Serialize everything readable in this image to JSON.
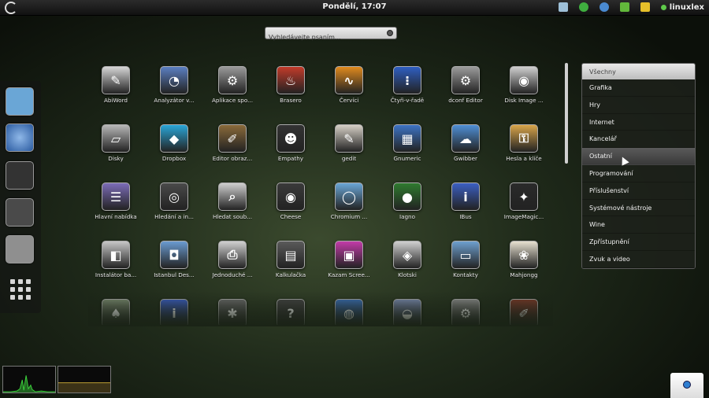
{
  "top_panel": {
    "clock": "Pondělí, 17:07",
    "user": "linuxlex",
    "tray_icons": [
      {
        "name": "screen-icon",
        "color": "#9ec0d8"
      },
      {
        "name": "network-icon",
        "color": "#3fae3f"
      },
      {
        "name": "globe-icon",
        "color": "#4a8ad0"
      },
      {
        "name": "rss-icon",
        "color": "#62b83b"
      },
      {
        "name": "sparkle-icon",
        "color": "#e6c02a"
      }
    ]
  },
  "search": {
    "placeholder": "Vyhledávejte psaním..."
  },
  "dock": {
    "items": [
      {
        "name": "chromium-icon",
        "color": "#6aa6d6"
      },
      {
        "name": "globe-icon",
        "color": "#3b6fb5"
      },
      {
        "name": "empathy-icon",
        "color": "#444444"
      },
      {
        "name": "binoculars-icon",
        "color": "#555555"
      },
      {
        "name": "file-cabinet-icon",
        "color": "#8f8f8f"
      }
    ]
  },
  "apps": [
    {
      "label": "AbiWord",
      "icon": "abiword-icon",
      "color": "#d6d6d6",
      "glyph": "✎"
    },
    {
      "label": "Analyzátor v...",
      "icon": "disk-analyzer-icon",
      "color": "#5b7fc2",
      "glyph": "◔"
    },
    {
      "label": "Aplikace spo...",
      "icon": "startup-apps-icon",
      "color": "#9a9a9a",
      "glyph": "⚙"
    },
    {
      "label": "Brasero",
      "icon": "brasero-icon",
      "color": "#c23b2a",
      "glyph": "♨"
    },
    {
      "label": "Červíci",
      "icon": "worms-icon",
      "color": "#e08a1e",
      "glyph": "∿"
    },
    {
      "label": "Čtyři-v-řadě",
      "icon": "four-in-row-icon",
      "color": "#2f5fc2",
      "glyph": "⁝"
    },
    {
      "label": "dconf Editor",
      "icon": "gear-icon",
      "color": "#9c9c9c",
      "glyph": "⚙"
    },
    {
      "label": "Disk Image ...",
      "icon": "disk-image-icon",
      "color": "#d0d0d0",
      "glyph": "◉"
    },
    {
      "label": "Disky",
      "icon": "disks-icon",
      "color": "#b8b8b8",
      "glyph": "▱"
    },
    {
      "label": "Dropbox",
      "icon": "dropbox-icon",
      "color": "#2aa6d8",
      "glyph": "◆"
    },
    {
      "label": "Editor obraz...",
      "icon": "gimp-icon",
      "color": "#8a6a3a",
      "glyph": "✐"
    },
    {
      "label": "Empathy",
      "icon": "empathy-icon",
      "color": "#333333",
      "glyph": "☻"
    },
    {
      "label": "gedit",
      "icon": "gedit-icon",
      "color": "#d6d0c6",
      "glyph": "✎"
    },
    {
      "label": "Gnumeric",
      "icon": "gnumeric-icon",
      "color": "#3d73c4",
      "glyph": "▦"
    },
    {
      "label": "Gwibber",
      "icon": "gwibber-icon",
      "color": "#4f8fd6",
      "glyph": "☁"
    },
    {
      "label": "Hesla a klíče",
      "icon": "keys-icon",
      "color": "#d9a54a",
      "glyph": "⚿"
    },
    {
      "label": "Hlavní nabídka",
      "icon": "main-menu-icon",
      "color": "#7c6cb8",
      "glyph": "☰"
    },
    {
      "label": "Hledání a in...",
      "icon": "binoculars-icon",
      "color": "#4a4a4a",
      "glyph": "◎"
    },
    {
      "label": "Hledat soub...",
      "icon": "magnifier-icon",
      "color": "#cfcfcf",
      "glyph": "⌕"
    },
    {
      "label": "Cheese",
      "icon": "cheese-icon",
      "color": "#3a3a3a",
      "glyph": "◉"
    },
    {
      "label": "Chromium ...",
      "icon": "chromium-icon",
      "color": "#6aa6d6",
      "glyph": "◯"
    },
    {
      "label": "Iagno",
      "icon": "iagno-icon",
      "color": "#2f7a2f",
      "glyph": "●"
    },
    {
      "label": "IBus",
      "icon": "ibus-icon",
      "color": "#3b5fc2",
      "glyph": "i"
    },
    {
      "label": "ImageMagic...",
      "icon": "imagemagick-icon",
      "color": "#2a2a2a",
      "glyph": "✦"
    },
    {
      "label": "Instalátor ba...",
      "icon": "deb-installer-icon",
      "color": "#c6c6c6",
      "glyph": "◧"
    },
    {
      "label": "Istanbul Des...",
      "icon": "istanbul-icon",
      "color": "#6a9ad0",
      "glyph": "◘"
    },
    {
      "label": "Jednoduché ...",
      "icon": "scan-icon",
      "color": "#d0d0d0",
      "glyph": "⎙"
    },
    {
      "label": "Kalkulačka",
      "icon": "calculator-icon",
      "color": "#5a5a5a",
      "glyph": "▤"
    },
    {
      "label": "Kazam Scree...",
      "icon": "kazam-icon",
      "color": "#c23ba8",
      "glyph": "▣"
    },
    {
      "label": "Klotski",
      "icon": "klotski-icon",
      "color": "#d0d0d0",
      "glyph": "◈"
    },
    {
      "label": "Kontakty",
      "icon": "contacts-icon",
      "color": "#6e9fcf",
      "glyph": "▭"
    },
    {
      "label": "Mahjongg",
      "icon": "mahjongg-icon",
      "color": "#e6e0d0",
      "glyph": "❀"
    },
    {
      "label": "",
      "icon": "cards-icon",
      "color": "#7a8a70",
      "glyph": "♠"
    },
    {
      "label": "",
      "icon": "info-icon",
      "color": "#3b5fc2",
      "glyph": "i"
    },
    {
      "label": "",
      "icon": "bug-icon",
      "color": "#6a6a6a",
      "glyph": "✱"
    },
    {
      "label": "",
      "icon": "help-icon",
      "color": "#444444",
      "glyph": "?"
    },
    {
      "label": "",
      "icon": "globe-icon",
      "color": "#3b6fb5",
      "glyph": "◍"
    },
    {
      "label": "",
      "icon": "pidgin-icon",
      "color": "#7a8ab0",
      "glyph": "◒"
    },
    {
      "label": "",
      "icon": "settings-icon",
      "color": "#8a8a8a",
      "glyph": "⚙"
    },
    {
      "label": "",
      "icon": "sketch-icon",
      "color": "#7a3a2a",
      "glyph": "✐"
    }
  ],
  "categories": {
    "header": "Všechny",
    "items": [
      "Grafika",
      "Hry",
      "Internet",
      "Kancelář",
      "Ostatní",
      "Programování",
      "Příslušenství",
      "Systémové nástroje",
      "Wine",
      "Zpřístupnění",
      "Zvuk a video"
    ],
    "active": "Ostatní"
  },
  "monitors": [
    {
      "name": "cpu-monitor",
      "line_color": "#3cd23c"
    },
    {
      "name": "memory-monitor",
      "line_color": "#d8b43a"
    }
  ]
}
